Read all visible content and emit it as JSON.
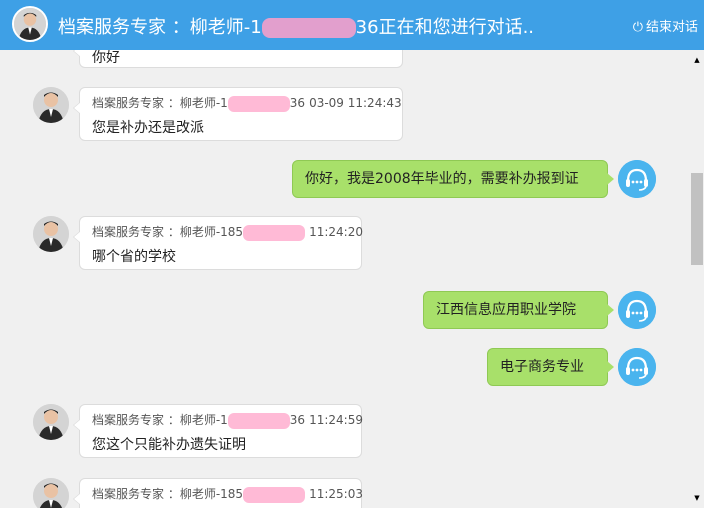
{
  "header": {
    "title_prefix": "档案服务专家 ：柳老师-1",
    "title_suffix": "36正在和您进行对话..",
    "end_chat_label": "结束对话"
  },
  "messages": [
    {
      "side": "left",
      "sender": "",
      "time": "",
      "text": "你好"
    },
    {
      "side": "left",
      "sender": "档案服务专家 ：柳老师-1",
      "sender_tail": "36",
      "time": "03-09 11:24:43",
      "text": "您是补办还是改派"
    },
    {
      "side": "right",
      "text": "你好，我是2008年毕业的，需要补办报到证"
    },
    {
      "side": "left",
      "sender": "档案服务专家 ：柳老师-185",
      "sender_tail": "",
      "time": "11:24:20",
      "text": "哪个省的学校"
    },
    {
      "side": "right",
      "text": "江西信息应用职业学院"
    },
    {
      "side": "right",
      "text": "电子商务专业"
    },
    {
      "side": "left",
      "sender": "档案服务专家 ：柳老师-1",
      "sender_tail": "36",
      "time": "11:24:59",
      "text": "您这个只能补办遗失证明"
    },
    {
      "side": "left",
      "sender": "档案服务专家 ：柳老师-185",
      "sender_tail": "",
      "time": "11:25:03",
      "text": ""
    }
  ],
  "colors": {
    "header_bg": "#3ea0e6",
    "right_bubble": "#a8e06a",
    "cs_avatar": "#4ab4ee"
  },
  "icons": {
    "end_chat": "power-icon",
    "customer_avatar": "headset-icon"
  }
}
